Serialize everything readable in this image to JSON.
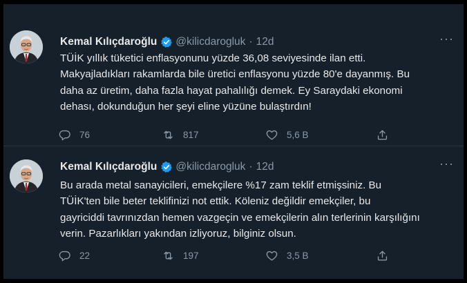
{
  "tweets": [
    {
      "author": "Kemal Kılıçdaroğlu",
      "handle": "@kilicdarogluk",
      "separator": "·",
      "time": "12d",
      "lines": [
        "TÜİK yıllık tüketici enflasyonunu yüzde 36,08 seviyesinde ilan etti.",
        "Makyajladıkları rakamlarda bile üretici enflasyonu yüzde 80'e dayanmış. Bu",
        "daha az üretim, daha fazla hayat pahalılığı demek. Ey Saraydaki ekonomi",
        "dehası, dokunduğun her şeyi eline yüzüne bulaştırdın!"
      ],
      "replies": "76",
      "retweets": "817",
      "likes": "5,6 B"
    },
    {
      "author": "Kemal Kılıçdaroğlu",
      "handle": "@kilicdarogluk",
      "separator": "·",
      "time": "12d",
      "lines": [
        "Bu arada metal sanayicileri, emekçilere %17 zam teklif etmişsiniz. Bu",
        "TÜİK'ten bile beter teklifinizi not ettik. Köleniz değildir emekçiler, bu",
        "gayriciddi tavrınızdan hemen vazgeçin ve emekçilerin alın terlerinin karşılığını",
        "verin. Pazarlıkları yakından izliyoruz, bilginiz olsun."
      ],
      "replies": "22",
      "retweets": "197",
      "likes": "3,5 B"
    }
  ],
  "icons": {
    "verified": "verified-badge-icon",
    "more": "more-options-icon",
    "reply": "reply-icon",
    "retweet": "retweet-icon",
    "like": "like-icon",
    "share": "share-icon"
  },
  "colors": {
    "background": "#15202b",
    "text": "#e7e9ea",
    "muted": "#8b98a5",
    "verified": "#1d9bf0"
  }
}
